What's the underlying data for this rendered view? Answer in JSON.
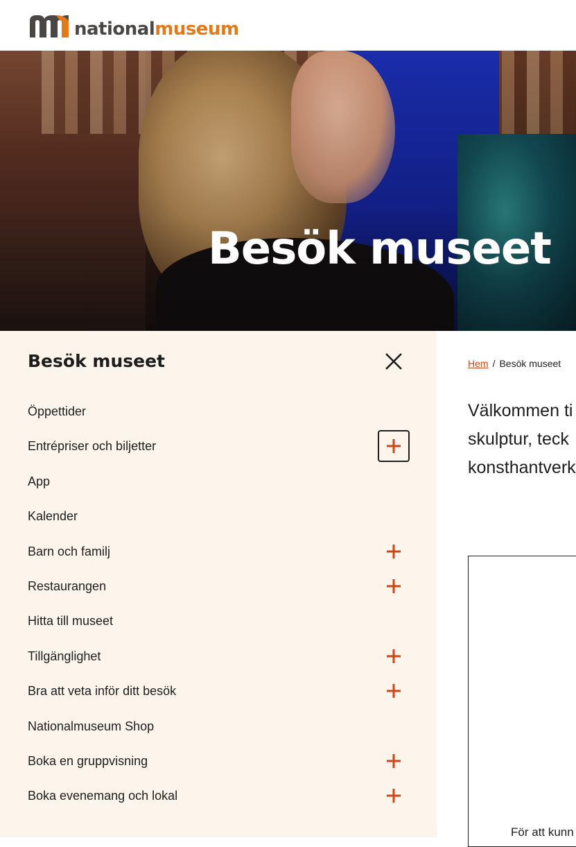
{
  "brand": {
    "name_part1": "national",
    "name_part2": "museum",
    "accent_color": "#e07a1a",
    "dark_color": "#4a4643"
  },
  "hero": {
    "title": "Besök museet"
  },
  "sidebar": {
    "title": "Besök museet",
    "close_icon": "close-icon",
    "background": "#fdf5ec",
    "plus_color": "#c9461a",
    "items": [
      {
        "label": "Öppettider",
        "expandable": false
      },
      {
        "label": "Entrépriser och biljetter",
        "expandable": true,
        "focused": true
      },
      {
        "label": "App",
        "expandable": false
      },
      {
        "label": "Kalender",
        "expandable": false
      },
      {
        "label": "Barn och familj",
        "expandable": true
      },
      {
        "label": "Restaurangen",
        "expandable": true
      },
      {
        "label": "Hitta till museet",
        "expandable": false
      },
      {
        "label": "Tillgänglighet",
        "expandable": true
      },
      {
        "label": "Bra att veta inför ditt besök",
        "expandable": true
      },
      {
        "label": "Nationalmuseum Shop",
        "expandable": false
      },
      {
        "label": "Boka en gruppvisning",
        "expandable": true
      },
      {
        "label": "Boka evenemang och lokal",
        "expandable": true
      }
    ]
  },
  "breadcrumb": {
    "home": "Hem",
    "separator": "/",
    "current": "Besök museet"
  },
  "main": {
    "intro_lines": [
      "Välkommen ti",
      "skulptur, teck",
      "konsthantverk"
    ],
    "embed_text": "För att kunn"
  }
}
